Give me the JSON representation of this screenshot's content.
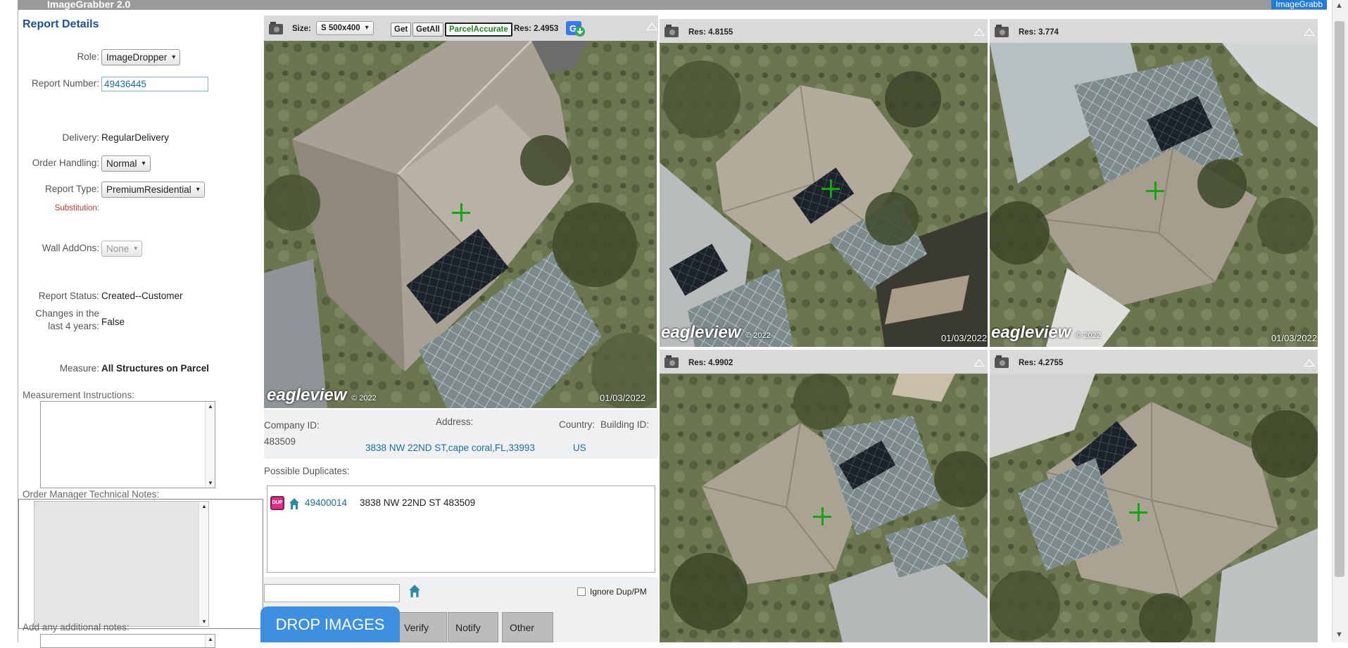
{
  "app": {
    "title": "ImageGrabber 2.0",
    "brand_tag": "ImageGrabb"
  },
  "left": {
    "heading": "Report Details",
    "role": {
      "label": "Role:",
      "value": "ImageDropper"
    },
    "report_number": {
      "label": "Report Number:",
      "value": "49436445"
    },
    "delivery": {
      "label": "Delivery:",
      "value": "RegularDelivery"
    },
    "order_handling": {
      "label": "Order Handling:",
      "value": "Normal"
    },
    "report_type": {
      "label": "Report Type:",
      "value": "PremiumResidential"
    },
    "substitution": {
      "label": "Substitution:"
    },
    "wall_addons": {
      "label": "Wall AddOns:",
      "value": "None"
    },
    "report_status": {
      "label": "Report Status:",
      "value": "Created--Customer"
    },
    "changes": {
      "label_line1": "Changes in the",
      "label_line2": "last 4 years:",
      "value": "False"
    },
    "measure": {
      "label": "Measure:",
      "value": "All Structures on Parcel"
    },
    "measurement_instructions": "Measurement Instructions:",
    "tech_notes": "Order Manager Technical Notes:",
    "additional_notes": "Add any additional notes:"
  },
  "main_tile": {
    "size_label": "Size:",
    "size_value": "S   500x400",
    "get": "Get",
    "get_all": "GetAll",
    "parcel": "ParcelAccurate",
    "res": "Res: 2.4953",
    "watermark": "eagleview",
    "watermark_year": "© 2022",
    "date": "01/03/2022"
  },
  "info": {
    "company_label": "Company ID:",
    "company_value": "483509",
    "address_label": "Address:",
    "address_value": "3838 NW 22ND ST,cape coral,FL,33993",
    "country_label": "Country:",
    "country_value": "US",
    "building_label": "Building ID:"
  },
  "duplicates": {
    "label": "Possible Duplicates:",
    "items": [
      {
        "badge": "DUP",
        "id": "49400014",
        "text": "3838 NW 22ND ST 483509"
      }
    ]
  },
  "bottom": {
    "ignore_label": "Ignore Dup/PM",
    "drop": "DROP IMAGES",
    "verify": "Verify",
    "notify": "Notify",
    "other": "Other"
  },
  "tiles": [
    {
      "res": "Res: 4.8155",
      "watermark": "eagleview",
      "year": "© 2022",
      "date": "01/03/2022"
    },
    {
      "res": "Res: 3.774",
      "watermark": "eagleview",
      "year": "© 2022",
      "date": "01/03/2022"
    },
    {
      "res": "Res: 4.9902"
    },
    {
      "res": "Res: 4.2755"
    }
  ]
}
